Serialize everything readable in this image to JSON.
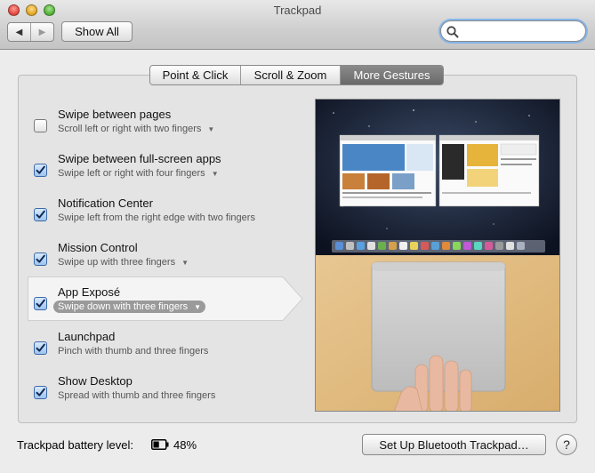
{
  "window": {
    "title": "Trackpad"
  },
  "toolbar": {
    "back_icon": "back-arrow-icon",
    "forward_icon": "forward-arrow-icon",
    "back_glyph": "◀",
    "forward_glyph": "▶",
    "show_all_label": "Show All",
    "search_value": "",
    "search_placeholder": ""
  },
  "tabs": [
    {
      "label": "Point & Click",
      "active": false
    },
    {
      "label": "Scroll & Zoom",
      "active": false
    },
    {
      "label": "More Gestures",
      "active": true
    }
  ],
  "gestures": [
    {
      "title": "Swipe between pages",
      "subtitle": "Scroll left or right with two fingers",
      "checked": false,
      "has_menu": true,
      "selected": false
    },
    {
      "title": "Swipe between full-screen apps",
      "subtitle": "Swipe left or right with four fingers",
      "checked": true,
      "has_menu": true,
      "selected": false
    },
    {
      "title": "Notification Center",
      "subtitle": "Swipe left from the right edge with two fingers",
      "checked": true,
      "has_menu": false,
      "selected": false
    },
    {
      "title": "Mission Control",
      "subtitle": "Swipe up with three fingers",
      "checked": true,
      "has_menu": true,
      "selected": false
    },
    {
      "title": "App Exposé",
      "subtitle": "Swipe down with three fingers",
      "checked": true,
      "has_menu": true,
      "selected": true
    },
    {
      "title": "Launchpad",
      "subtitle": "Pinch with thumb and three fingers",
      "checked": true,
      "has_menu": false,
      "selected": false
    },
    {
      "title": "Show Desktop",
      "subtitle": "Spread with thumb and three fingers",
      "checked": true,
      "has_menu": false,
      "selected": false
    }
  ],
  "menu_arrow": "▼",
  "footer": {
    "battery_label": "Trackpad battery level:",
    "battery_percent": "48%",
    "battery_level": 0.48,
    "bluetooth_button": "Set Up Bluetooth Trackpad…",
    "help_label": "?"
  },
  "colors": {
    "accent": "#3c6aa8",
    "selected_tab": "#777777",
    "pill": "#9a9a9a"
  }
}
